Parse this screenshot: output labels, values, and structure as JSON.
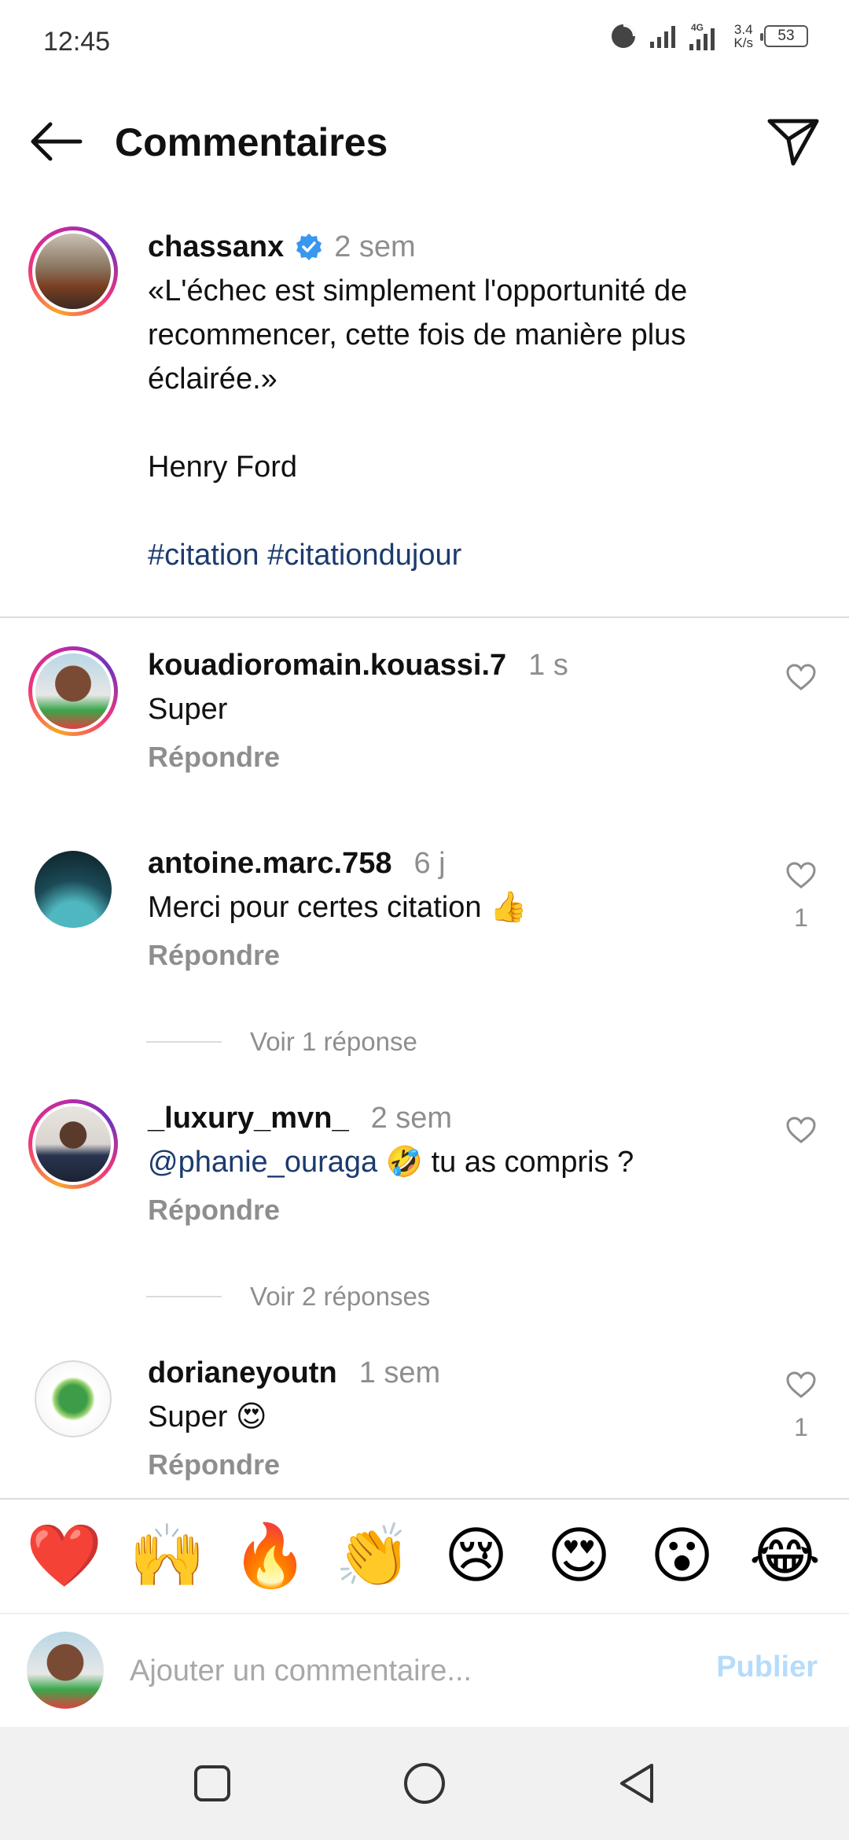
{
  "status_bar": {
    "time": "12:45",
    "network_type": "4G",
    "net_speed_value": "3.4",
    "net_speed_unit": "K/s",
    "battery": "53"
  },
  "header": {
    "title": "Commentaires",
    "back_icon": "arrow-left-icon",
    "share_icon": "paper-plane-icon"
  },
  "caption": {
    "username": "chassanx",
    "verified": true,
    "time": "2 sem",
    "lines": [
      "«L'échec est simplement l'opportunité de recommencer, cette fois de manière plus éclairée.»",
      "",
      "Henry Ford",
      ""
    ],
    "hashtags": "#citation #citationdujour"
  },
  "comments": [
    {
      "username": "kouadioromain.kouassi.7",
      "time": "1 s",
      "text": "Super",
      "reply_label": "Répondre",
      "likes": ""
    },
    {
      "username": "antoine.marc.758",
      "time": "6 j",
      "text": "Merci pour certes citation",
      "emoji": "👍",
      "reply_label": "Répondre",
      "likes": "1",
      "view_replies": "Voir 1 réponse"
    },
    {
      "username": "_luxury_mvn_",
      "time": "2 sem",
      "mention": "@phanie_ouraga",
      "emoji": "🤣",
      "text": "tu as compris ?",
      "reply_label": "Répondre",
      "likes": "",
      "view_replies": "Voir 2 réponses"
    },
    {
      "username": "dorianeyoutn",
      "time": "1 sem",
      "text": "Super",
      "emoji": "😍",
      "reply_label": "Répondre",
      "likes": "1"
    }
  ],
  "quick_reactions": [
    "❤️",
    "🙌",
    "🔥",
    "👏",
    "😢",
    "😍",
    "😮",
    "😂"
  ],
  "composer": {
    "placeholder": "Ajouter un commentaire...",
    "publish_label": "Publier"
  },
  "colors": {
    "link": "#1c3b6e",
    "muted": "#8e8e8e",
    "verified": "#3897f0",
    "publish_disabled": "#b6dcfb"
  }
}
